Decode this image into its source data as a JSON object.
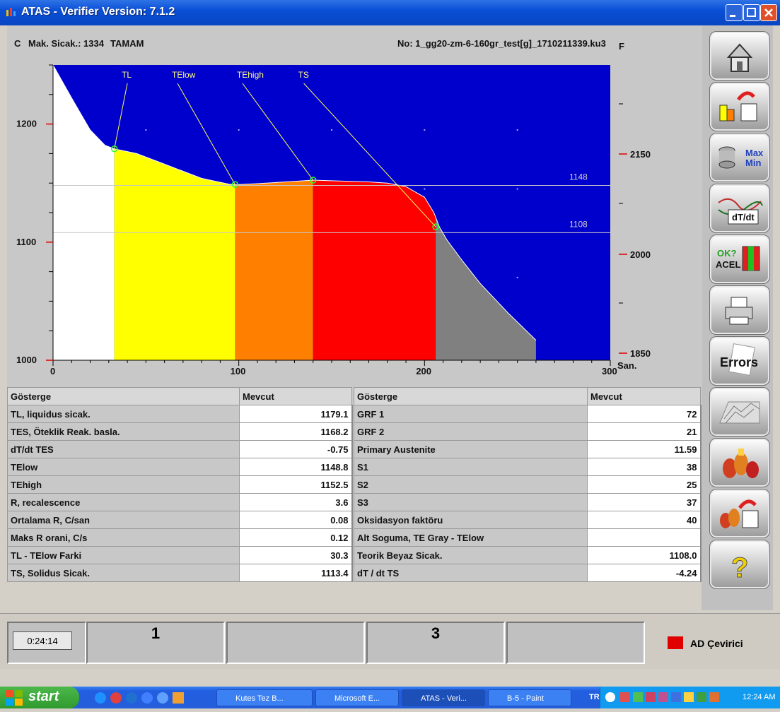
{
  "window": {
    "title": "ATAS - Verifier Version: 7.1.2"
  },
  "header": {
    "unit_left": "C",
    "max_temp": "Mak. Sicak.: 1334",
    "status": "TAMAM",
    "file_no": "No: 1_gg20-zm-6-160gr_test[g]_1710211339.ku3",
    "unit_right": "F"
  },
  "chart_data": {
    "type": "area",
    "x_axis": {
      "ticks": [
        "0",
        "100",
        "200",
        "300"
      ],
      "unit": "San.",
      "range": [
        0,
        300
      ]
    },
    "y_axis_left": {
      "ticks": [
        "1000",
        "1100",
        "1200"
      ],
      "range": [
        1000,
        1250
      ]
    },
    "y_axis_right": {
      "ticks": [
        "1850",
        "2000",
        "2150"
      ]
    },
    "series": [
      {
        "x": [
          0,
          10,
          20,
          28,
          33,
          45,
          60,
          80,
          95,
          100,
          110,
          120,
          130,
          140,
          150,
          160,
          170,
          180,
          190,
          200,
          205,
          208,
          212,
          220,
          230,
          245,
          260
        ],
        "y": [
          1250,
          1222,
          1195,
          1182,
          1179,
          1175,
          1166,
          1154,
          1149,
          1148.8,
          1149.5,
          1150.5,
          1151.5,
          1152.5,
          1152,
          1151.5,
          1151,
          1150,
          1147,
          1138,
          1125,
          1113,
          1102,
          1085,
          1065,
          1040,
          1017
        ]
      }
    ],
    "regions": [
      {
        "from": 0,
        "to": 33,
        "color": "#ffffff"
      },
      {
        "from": 33,
        "to": 98,
        "color": "#ffff00"
      },
      {
        "from": 98,
        "to": 140,
        "color": "#ff8000"
      },
      {
        "from": 140,
        "to": 206,
        "color": "#ff0000"
      },
      {
        "from": 206,
        "to": 260,
        "color": "#808080"
      }
    ],
    "annotations": [
      {
        "label": "TL",
        "label_x": 40,
        "x": 33,
        "y": 1179
      },
      {
        "label": "TElow",
        "label_x": 67,
        "x": 98,
        "y": 1148.8
      },
      {
        "label": "TEhigh",
        "label_x": 102,
        "x": 140,
        "y": 1152.5
      },
      {
        "label": "TS",
        "label_x": 135,
        "x": 206,
        "y": 1113
      }
    ],
    "hlines": [
      {
        "label": "1148",
        "y": 1148
      },
      {
        "label": "1108",
        "y": 1108
      }
    ],
    "background": "#0000cc"
  },
  "table_left": {
    "headers": [
      "Gösterge",
      "Mevcut"
    ],
    "rows": [
      [
        "TL, liquidus sicak.",
        "1179.1"
      ],
      [
        "TES, Öteklik Reak. basla.",
        "1168.2"
      ],
      [
        "dT/dt TES",
        "-0.75"
      ],
      [
        "TElow",
        "1148.8"
      ],
      [
        "TEhigh",
        "1152.5"
      ],
      [
        "R, recalescence",
        "3.6"
      ],
      [
        "Ortalama R, C/san",
        "0.08"
      ],
      [
        "Maks R orani, C/s",
        "0.12"
      ],
      [
        "TL - TElow Farki",
        "30.3"
      ],
      [
        "TS, Solidus Sicak.",
        "1113.4"
      ]
    ]
  },
  "table_right": {
    "headers": [
      "Gösterge",
      "Mevcut"
    ],
    "rows": [
      [
        "GRF 1",
        "72"
      ],
      [
        "GRF 2",
        "21"
      ],
      [
        "Primary Austenite",
        "11.59"
      ],
      [
        "S1",
        "38"
      ],
      [
        "S2",
        "25"
      ],
      [
        "S3",
        "37"
      ],
      [
        "Oksidasyon faktöru",
        "40"
      ],
      [
        "Alt Soguma, TE Gray - TElow",
        ""
      ],
      [
        "Teorik Beyaz Sicak.",
        "1108.0"
      ],
      [
        "dT / dt TS",
        "-4.24"
      ]
    ]
  },
  "sidebar": {
    "buttons": [
      "home-icon",
      "export-icon",
      "max-min-icon",
      "dtdt-icon",
      "ok-acel-icon",
      "printer-icon",
      "errors-icon",
      "graph3d-icon",
      "bottles-icon",
      "bottles-export-icon",
      "help-icon"
    ],
    "max_label": "Max",
    "min_label": "Min",
    "dtdt_label": "dT/dt",
    "ok_label": "OK?",
    "acel_label": "ACEL",
    "errors_label": "Errors",
    "help_label": "?"
  },
  "status": {
    "timer": "0:24:14",
    "cell1": "1",
    "cell2": "",
    "cell3": "3",
    "cell4": "",
    "ad_label": "AD Çevirici",
    "ad_color": "#e00000"
  },
  "taskbar": {
    "start": "start",
    "items": [
      "Kutes Tez B...",
      "Microsoft E...",
      "ATAS - Veri...",
      "B-5 - Paint"
    ],
    "lang": "TR",
    "time": "12:24 AM"
  }
}
